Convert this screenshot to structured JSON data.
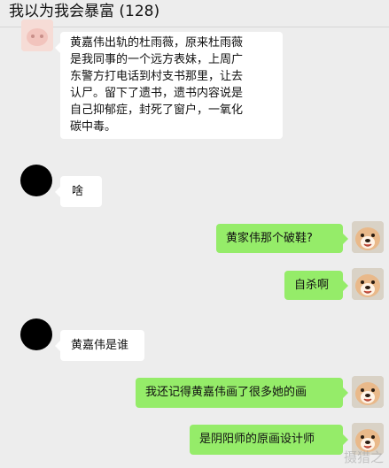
{
  "header": {
    "title": "我以为我会暴富 (128)"
  },
  "messages": [
    {
      "side": "left",
      "avatar": "pink-avatar",
      "lines": [
        "黄嘉伟出轨的杜雨薇，原来杜雨薇",
        "是我同事的一个远方表妹，上周广",
        "东警方打电话到村支书那里，让去",
        "认尸。留下了遗书，遗书内容说是",
        "自己抑郁症，封死了窗户，一氧化",
        "碳中毒。"
      ]
    },
    {
      "side": "left",
      "avatar": "black-avatar",
      "text": "啥"
    },
    {
      "side": "right",
      "avatar": "dog-avatar",
      "text": "黄家伟那个破鞋?"
    },
    {
      "side": "right",
      "avatar": "dog-avatar",
      "text": "自杀啊"
    },
    {
      "side": "left",
      "avatar": "black-avatar",
      "text": "黄嘉伟是谁"
    },
    {
      "side": "right",
      "avatar": "dog-avatar",
      "text": "我还记得黄嘉伟画了很多她的画"
    },
    {
      "side": "right",
      "avatar": "dog-avatar",
      "text": "是阴阳师的原画设计师"
    }
  ],
  "watermark": "摄猎之"
}
